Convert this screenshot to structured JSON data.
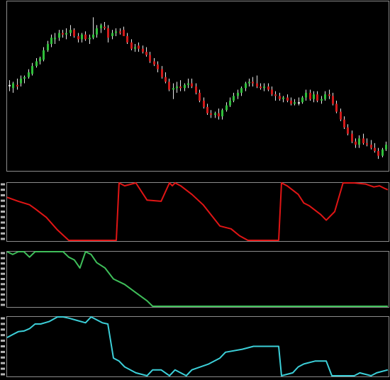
{
  "colors": {
    "background": "#000000",
    "frame": "#8c8c8c",
    "up": "#2fbf3a",
    "down": "#d21a1a",
    "neutral": "#e6e6e6",
    "red_line": "#e01515",
    "green_line": "#3fbf5a",
    "cyan_line": "#3ccfd8",
    "tick_label": "#b4b4b4"
  },
  "chart_data": [
    {
      "type": "candlestick",
      "panel": "price",
      "ylim": [
        0,
        100
      ],
      "candles": [
        {
          "o": 51,
          "h": 54,
          "l": 47,
          "c": 51
        },
        {
          "o": 49,
          "h": 53,
          "l": 46,
          "c": 52
        },
        {
          "o": 51,
          "h": 55,
          "l": 48,
          "c": 50
        },
        {
          "o": 52,
          "h": 57,
          "l": 50,
          "c": 55
        },
        {
          "o": 55,
          "h": 57,
          "l": 52,
          "c": 56
        },
        {
          "o": 56,
          "h": 61,
          "l": 55,
          "c": 59
        },
        {
          "o": 58,
          "h": 65,
          "l": 57,
          "c": 63
        },
        {
          "o": 63,
          "h": 68,
          "l": 62,
          "c": 66
        },
        {
          "o": 66,
          "h": 69,
          "l": 64,
          "c": 68
        },
        {
          "o": 67,
          "h": 75,
          "l": 66,
          "c": 73
        },
        {
          "o": 73,
          "h": 79,
          "l": 72,
          "c": 77
        },
        {
          "o": 77,
          "h": 83,
          "l": 75,
          "c": 81
        },
        {
          "o": 80,
          "h": 84,
          "l": 77,
          "c": 81
        },
        {
          "o": 81,
          "h": 86,
          "l": 79,
          "c": 84
        },
        {
          "o": 84,
          "h": 86,
          "l": 81,
          "c": 83
        },
        {
          "o": 83,
          "h": 87,
          "l": 80,
          "c": 84
        },
        {
          "o": 84,
          "h": 89,
          "l": 82,
          "c": 86
        },
        {
          "o": 86,
          "h": 87,
          "l": 81,
          "c": 82
        },
        {
          "o": 82,
          "h": 84,
          "l": 78,
          "c": 80
        },
        {
          "o": 80,
          "h": 84,
          "l": 78,
          "c": 83
        },
        {
          "o": 83,
          "h": 85,
          "l": 79,
          "c": 80
        },
        {
          "o": 80,
          "h": 83,
          "l": 77,
          "c": 81
        },
        {
          "o": 81,
          "h": 94,
          "l": 80,
          "c": 83
        },
        {
          "o": 83,
          "h": 89,
          "l": 81,
          "c": 87
        },
        {
          "o": 87,
          "h": 90,
          "l": 84,
          "c": 89
        },
        {
          "o": 88,
          "h": 91,
          "l": 86,
          "c": 87
        },
        {
          "o": 87,
          "h": 89,
          "l": 78,
          "c": 81
        },
        {
          "o": 82,
          "h": 86,
          "l": 80,
          "c": 84
        },
        {
          "o": 84,
          "h": 87,
          "l": 82,
          "c": 85
        },
        {
          "o": 85,
          "h": 87,
          "l": 83,
          "c": 84
        },
        {
          "o": 86,
          "h": 88,
          "l": 84,
          "c": 82
        },
        {
          "o": 82,
          "h": 84,
          "l": 77,
          "c": 78
        },
        {
          "o": 78,
          "h": 80,
          "l": 73,
          "c": 74
        },
        {
          "o": 74,
          "h": 77,
          "l": 72,
          "c": 75
        },
        {
          "o": 76,
          "h": 78,
          "l": 72,
          "c": 74
        },
        {
          "o": 74,
          "h": 76,
          "l": 71,
          "c": 72
        },
        {
          "o": 72,
          "h": 75,
          "l": 69,
          "c": 70
        },
        {
          "o": 70,
          "h": 72,
          "l": 65,
          "c": 66
        },
        {
          "o": 66,
          "h": 68,
          "l": 63,
          "c": 64
        },
        {
          "o": 64,
          "h": 66,
          "l": 59,
          "c": 61
        },
        {
          "o": 61,
          "h": 63,
          "l": 55,
          "c": 56
        },
        {
          "o": 56,
          "h": 59,
          "l": 52,
          "c": 53
        },
        {
          "o": 53,
          "h": 55,
          "l": 47,
          "c": 48
        },
        {
          "o": 48,
          "h": 52,
          "l": 42,
          "c": 49
        },
        {
          "o": 49,
          "h": 53,
          "l": 46,
          "c": 50
        },
        {
          "o": 50,
          "h": 54,
          "l": 47,
          "c": 49
        },
        {
          "o": 49,
          "h": 52,
          "l": 47,
          "c": 51
        },
        {
          "o": 51,
          "h": 55,
          "l": 49,
          "c": 52
        },
        {
          "o": 52,
          "h": 55,
          "l": 49,
          "c": 50
        },
        {
          "o": 50,
          "h": 52,
          "l": 45,
          "c": 46
        },
        {
          "o": 46,
          "h": 48,
          "l": 40,
          "c": 41
        },
        {
          "o": 41,
          "h": 43,
          "l": 36,
          "c": 37
        },
        {
          "o": 37,
          "h": 39,
          "l": 32,
          "c": 33
        },
        {
          "o": 33,
          "h": 35,
          "l": 30,
          "c": 32
        },
        {
          "o": 32,
          "h": 34,
          "l": 30,
          "c": 33
        },
        {
          "o": 33,
          "h": 36,
          "l": 29,
          "c": 31
        },
        {
          "o": 31,
          "h": 36,
          "l": 29,
          "c": 35
        },
        {
          "o": 35,
          "h": 40,
          "l": 34,
          "c": 38
        },
        {
          "o": 38,
          "h": 43,
          "l": 37,
          "c": 41
        },
        {
          "o": 41,
          "h": 46,
          "l": 40,
          "c": 44
        },
        {
          "o": 44,
          "h": 48,
          "l": 42,
          "c": 46
        },
        {
          "o": 46,
          "h": 50,
          "l": 44,
          "c": 49
        },
        {
          "o": 49,
          "h": 53,
          "l": 47,
          "c": 52
        },
        {
          "o": 52,
          "h": 55,
          "l": 50,
          "c": 53
        },
        {
          "o": 53,
          "h": 56,
          "l": 50,
          "c": 52
        },
        {
          "o": 52,
          "h": 57,
          "l": 49,
          "c": 50
        },
        {
          "o": 50,
          "h": 52,
          "l": 48,
          "c": 49
        },
        {
          "o": 49,
          "h": 52,
          "l": 47,
          "c": 50
        },
        {
          "o": 50,
          "h": 52,
          "l": 47,
          "c": 48
        },
        {
          "o": 48,
          "h": 50,
          "l": 44,
          "c": 45
        },
        {
          "o": 45,
          "h": 47,
          "l": 41,
          "c": 44
        },
        {
          "o": 44,
          "h": 46,
          "l": 41,
          "c": 42
        },
        {
          "o": 42,
          "h": 44,
          "l": 40,
          "c": 43
        },
        {
          "o": 43,
          "h": 45,
          "l": 40,
          "c": 41
        },
        {
          "o": 41,
          "h": 43,
          "l": 38,
          "c": 39
        },
        {
          "o": 39,
          "h": 42,
          "l": 38,
          "c": 40
        },
        {
          "o": 40,
          "h": 43,
          "l": 38,
          "c": 40
        },
        {
          "o": 40,
          "h": 44,
          "l": 39,
          "c": 43
        },
        {
          "o": 43,
          "h": 48,
          "l": 41,
          "c": 46
        },
        {
          "o": 46,
          "h": 48,
          "l": 41,
          "c": 42
        },
        {
          "o": 42,
          "h": 47,
          "l": 40,
          "c": 45
        },
        {
          "o": 45,
          "h": 47,
          "l": 40,
          "c": 41
        },
        {
          "o": 41,
          "h": 44,
          "l": 39,
          "c": 42
        },
        {
          "o": 42,
          "h": 47,
          "l": 41,
          "c": 45
        },
        {
          "o": 45,
          "h": 48,
          "l": 42,
          "c": 44
        },
        {
          "o": 44,
          "h": 46,
          "l": 38,
          "c": 39
        },
        {
          "o": 39,
          "h": 41,
          "l": 33,
          "c": 34
        },
        {
          "o": 34,
          "h": 36,
          "l": 28,
          "c": 29
        },
        {
          "o": 29,
          "h": 31,
          "l": 23,
          "c": 24
        },
        {
          "o": 24,
          "h": 26,
          "l": 19,
          "c": 20
        },
        {
          "o": 20,
          "h": 22,
          "l": 14,
          "c": 15
        },
        {
          "o": 15,
          "h": 17,
          "l": 11,
          "c": 13
        },
        {
          "o": 13,
          "h": 19,
          "l": 11,
          "c": 17
        },
        {
          "o": 17,
          "h": 20,
          "l": 13,
          "c": 14
        },
        {
          "o": 14,
          "h": 17,
          "l": 12,
          "c": 13
        },
        {
          "o": 13,
          "h": 16,
          "l": 10,
          "c": 11
        },
        {
          "o": 11,
          "h": 14,
          "l": 8,
          "c": 9
        },
        {
          "o": 9,
          "h": 11,
          "l": 4,
          "c": 6
        },
        {
          "o": 6,
          "h": 11,
          "l": 5,
          "c": 10
        },
        {
          "o": 10,
          "h": 15,
          "l": 9,
          "c": 13
        }
      ]
    },
    {
      "type": "line",
      "panel": "red",
      "ylim": [
        0,
        100
      ],
      "x": [
        0,
        4,
        8,
        10,
        14,
        18,
        22,
        28,
        31,
        36,
        38,
        39,
        40,
        42,
        46,
        50,
        55,
        58,
        59,
        60,
        62,
        66,
        70,
        76,
        80,
        83,
        86,
        90,
        94,
        96,
        97,
        98,
        100,
        104,
        106,
        108,
        112,
        114,
        117,
        120,
        124,
        128,
        131,
        133,
        135,
        136
      ],
      "y": [
        75,
        68,
        62,
        55,
        40,
        18,
        0,
        0,
        0,
        0,
        0,
        0,
        100,
        95,
        100,
        70,
        68,
        100,
        95,
        100,
        95,
        80,
        62,
        25,
        20,
        8,
        0,
        0,
        0,
        0,
        0,
        100,
        95,
        80,
        65,
        60,
        45,
        35,
        50,
        100,
        100,
        98,
        93,
        95,
        90,
        88
      ]
    },
    {
      "type": "line",
      "panel": "green",
      "ylim": [
        0,
        100
      ],
      "x": [
        0,
        2,
        4,
        6,
        8,
        10,
        15,
        20,
        22,
        24,
        26,
        28,
        30,
        32,
        35,
        38,
        42,
        46,
        50,
        52,
        55,
        60,
        70,
        80,
        90,
        100,
        110,
        120,
        136
      ],
      "y": [
        100,
        95,
        100,
        100,
        90,
        100,
        100,
        100,
        90,
        85,
        70,
        100,
        95,
        80,
        70,
        50,
        40,
        25,
        10,
        0,
        0,
        0,
        0,
        0,
        0,
        0,
        0,
        0,
        0
      ]
    },
    {
      "type": "line",
      "panel": "cyan",
      "ylim": [
        0,
        100
      ],
      "x": [
        0,
        2,
        4,
        6,
        8,
        10,
        12,
        15,
        18,
        20,
        22,
        25,
        28,
        30,
        34,
        36,
        38,
        40,
        42,
        46,
        50,
        52,
        55,
        58,
        60,
        62,
        64,
        66,
        72,
        76,
        78,
        84,
        88,
        92,
        94,
        96,
        97,
        98,
        102,
        104,
        106,
        110,
        114,
        116,
        124,
        126,
        130,
        132,
        136
      ],
      "y": [
        65,
        70,
        75,
        76,
        80,
        88,
        88,
        92,
        100,
        100,
        98,
        94,
        90,
        100,
        90,
        88,
        30,
        25,
        15,
        5,
        0,
        10,
        10,
        0,
        10,
        5,
        0,
        10,
        20,
        30,
        40,
        45,
        50,
        50,
        50,
        50,
        50,
        0,
        5,
        15,
        20,
        25,
        25,
        0,
        0,
        5,
        0,
        5,
        10
      ]
    }
  ]
}
